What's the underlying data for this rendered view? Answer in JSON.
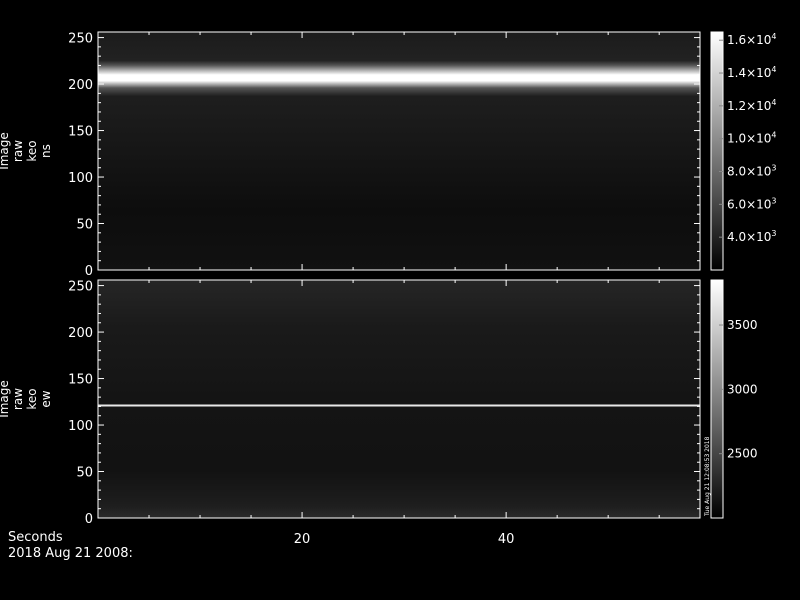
{
  "footer": {
    "xlabel": "Seconds",
    "date": "2018 Aug 21 2008:"
  },
  "chart_data": [
    {
      "type": "heatmap",
      "panel": "top",
      "ylabel_lines": [
        "Image",
        "raw",
        "keo",
        "ns"
      ],
      "x_range": [
        0,
        59
      ],
      "y_range": [
        0,
        256
      ],
      "y_ticks": [
        0,
        50,
        100,
        150,
        200,
        250
      ],
      "x_ticks": [
        20,
        40
      ],
      "x_tick_labels_shown": false,
      "features": [
        {
          "type": "bright-band",
          "y_center": 204,
          "y_halfwidth": 7,
          "intensity": 16000
        },
        {
          "type": "dim-region",
          "y_range": [
            60,
            120
          ],
          "intensity": 2600
        }
      ],
      "background_intensity": 2900,
      "colorbar": {
        "range": [
          2000,
          16500
        ],
        "ticks": [
          {
            "value": 16000,
            "mantissa": "1.6",
            "exp": "4"
          },
          {
            "value": 14000,
            "mantissa": "1.4",
            "exp": "4"
          },
          {
            "value": 12000,
            "mantissa": "1.2",
            "exp": "4"
          },
          {
            "value": 10000,
            "mantissa": "1.0",
            "exp": "4"
          },
          {
            "value": 8000,
            "mantissa": "8.0",
            "exp": "3"
          },
          {
            "value": 6000,
            "mantissa": "6.0",
            "exp": "3"
          },
          {
            "value": 4000,
            "mantissa": "4.0",
            "exp": "3"
          }
        ]
      }
    },
    {
      "type": "heatmap",
      "panel": "bottom",
      "ylabel_lines": [
        "Image",
        "raw",
        "keo",
        "ew"
      ],
      "x_range": [
        0,
        59
      ],
      "y_range": [
        0,
        256
      ],
      "y_ticks": [
        0,
        50,
        100,
        150,
        200,
        250
      ],
      "x_ticks": [
        20,
        40
      ],
      "x_tick_labels_shown": true,
      "features": [
        {
          "type": "thin-line",
          "y": 121,
          "intensity": 3800
        },
        {
          "type": "bright-band",
          "y_range": [
            200,
            256
          ],
          "intensity": 2250
        },
        {
          "type": "bright-band",
          "y_range": [
            0,
            60
          ],
          "intensity": 2250
        }
      ],
      "background_intensity": 2150,
      "colorbar": {
        "range": [
          2000,
          3850
        ],
        "ticks": [
          {
            "value": 3500,
            "label": "3500"
          },
          {
            "value": 3000,
            "label": "3000"
          },
          {
            "value": 2500,
            "label": "2500"
          }
        ],
        "side_annotation": "Tue Aug 21 12:08:53 2018"
      }
    }
  ]
}
